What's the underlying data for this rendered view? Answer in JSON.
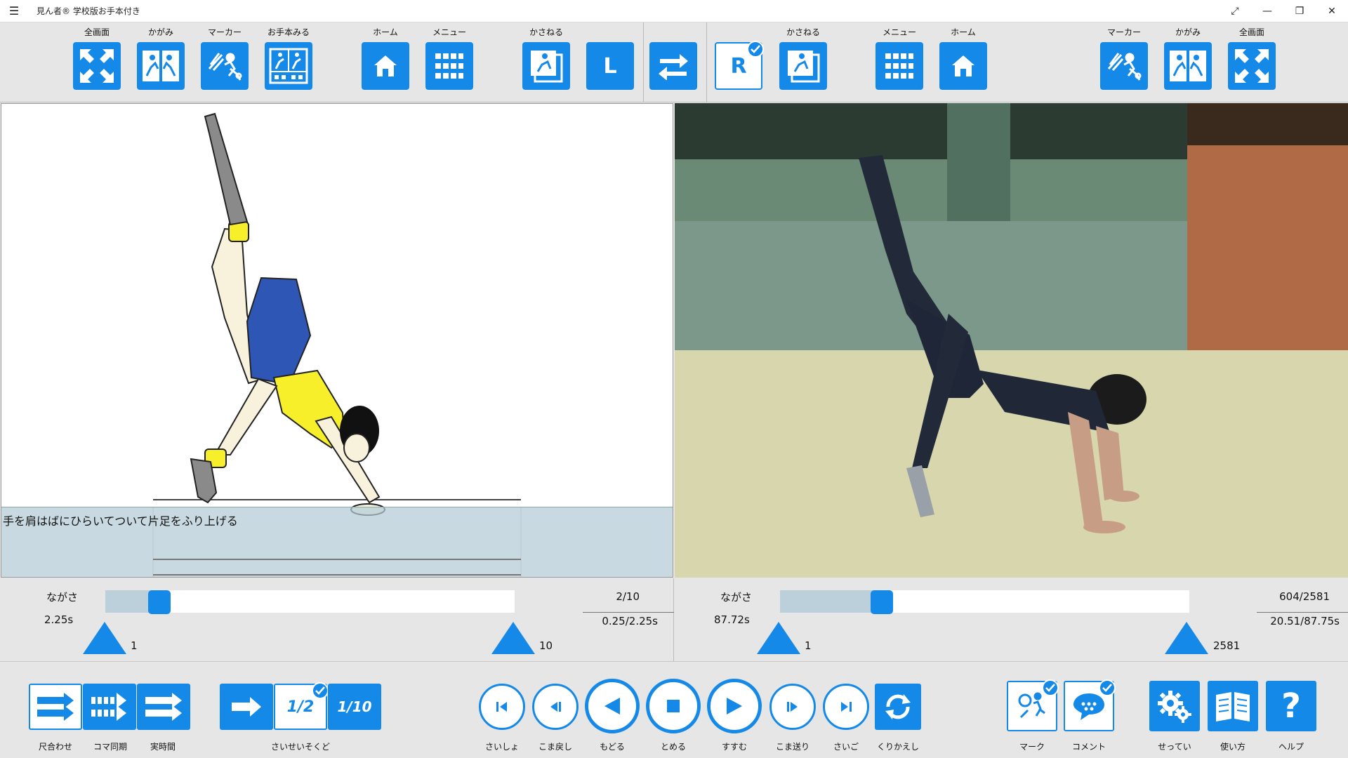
{
  "window": {
    "title": "見ん者® 学校版お手本付き"
  },
  "toolbar": {
    "left": {
      "fullscreen": "全画面",
      "mirror": "かがみ",
      "marker": "マーカー",
      "model": "お手本みる",
      "home": "ホーム",
      "menu": "メニュー",
      "overlay": "かさねる",
      "l_label": "L"
    },
    "right": {
      "r_label": "R",
      "overlay": "かさねる",
      "menu": "メニュー",
      "home": "ホーム",
      "marker": "マーカー",
      "mirror": "かがみ",
      "fullscreen": "全画面"
    }
  },
  "left_panel": {
    "caption": "手を肩はばにひらいてついて片足をふり上げる"
  },
  "left_slider": {
    "length_label": "ながさ",
    "duration": "2.25s",
    "frame": "2/10",
    "time": "0.25/2.25s",
    "start_marker": "1",
    "end_marker": "10",
    "position": 2,
    "total": 10
  },
  "right_slider": {
    "length_label": "ながさ",
    "duration": "87.72s",
    "frame": "604/2581",
    "time": "20.51/87.75s",
    "start_marker": "1",
    "end_marker": "2581",
    "position": 604,
    "total": 2581
  },
  "controls": {
    "scale_match": "尺合わせ",
    "frame_sync": "コマ同期",
    "real_time": "実時間",
    "speed": "さいせいそくど",
    "half": "1/2",
    "tenth": "1/10",
    "first": "さいしょ",
    "step_back": "こま戻し",
    "back": "もどる",
    "stop": "とめる",
    "forward": "すすむ",
    "step_forward": "こま送り",
    "last": "さいご",
    "repeat": "くりかえし",
    "mark": "マーク",
    "comment": "コメント",
    "settings": "せってい",
    "howto": "使い方",
    "help": "ヘルプ"
  },
  "colors": {
    "accent": "#1589e8",
    "background": "#e6e6e6"
  }
}
